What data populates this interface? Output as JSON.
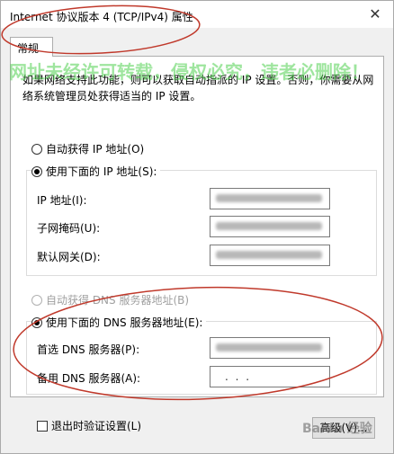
{
  "window": {
    "title": "Internet 协议版本 4 (TCP/IPv4) 属性",
    "close_glyph": "✕"
  },
  "tabs": [
    {
      "label": "常规"
    }
  ],
  "description": "如果网络支持此功能，则可以获取自动指派的 IP 设置。否则，你需要从网络系统管理员处获得适当的 IP 设置。",
  "ip_section": {
    "auto_radio": {
      "label": "自动获得 IP 地址(O)",
      "selected": false
    },
    "manual_radio": {
      "label": "使用下面的 IP 地址(S):",
      "selected": true
    },
    "fields": [
      {
        "label": "IP 地址(I):",
        "value_state": "obscured"
      },
      {
        "label": "子网掩码(U):",
        "value_state": "obscured"
      },
      {
        "label": "默认网关(D):",
        "value_state": "obscured"
      }
    ]
  },
  "dns_section": {
    "auto_radio": {
      "label": "自动获得 DNS 服务器地址(B)",
      "selected": false,
      "enabled": false
    },
    "manual_radio": {
      "label": "使用下面的 DNS 服务器地址(E):",
      "selected": true
    },
    "fields": [
      {
        "label": "首选 DNS 服务器(P):",
        "value_state": "obscured"
      },
      {
        "label": "备用 DNS 服务器(A):",
        "value": ".   .   ."
      }
    ]
  },
  "validate_checkbox": {
    "label": "退出时验证设置(L)",
    "checked": false
  },
  "advanced_button": {
    "label": "高级(V)..."
  },
  "overlay": {
    "watermark": "网址未经许可转载，侵权必究，违者必删除！",
    "brand": "Baidu 经验",
    "annotation_color": "#c0392b"
  }
}
